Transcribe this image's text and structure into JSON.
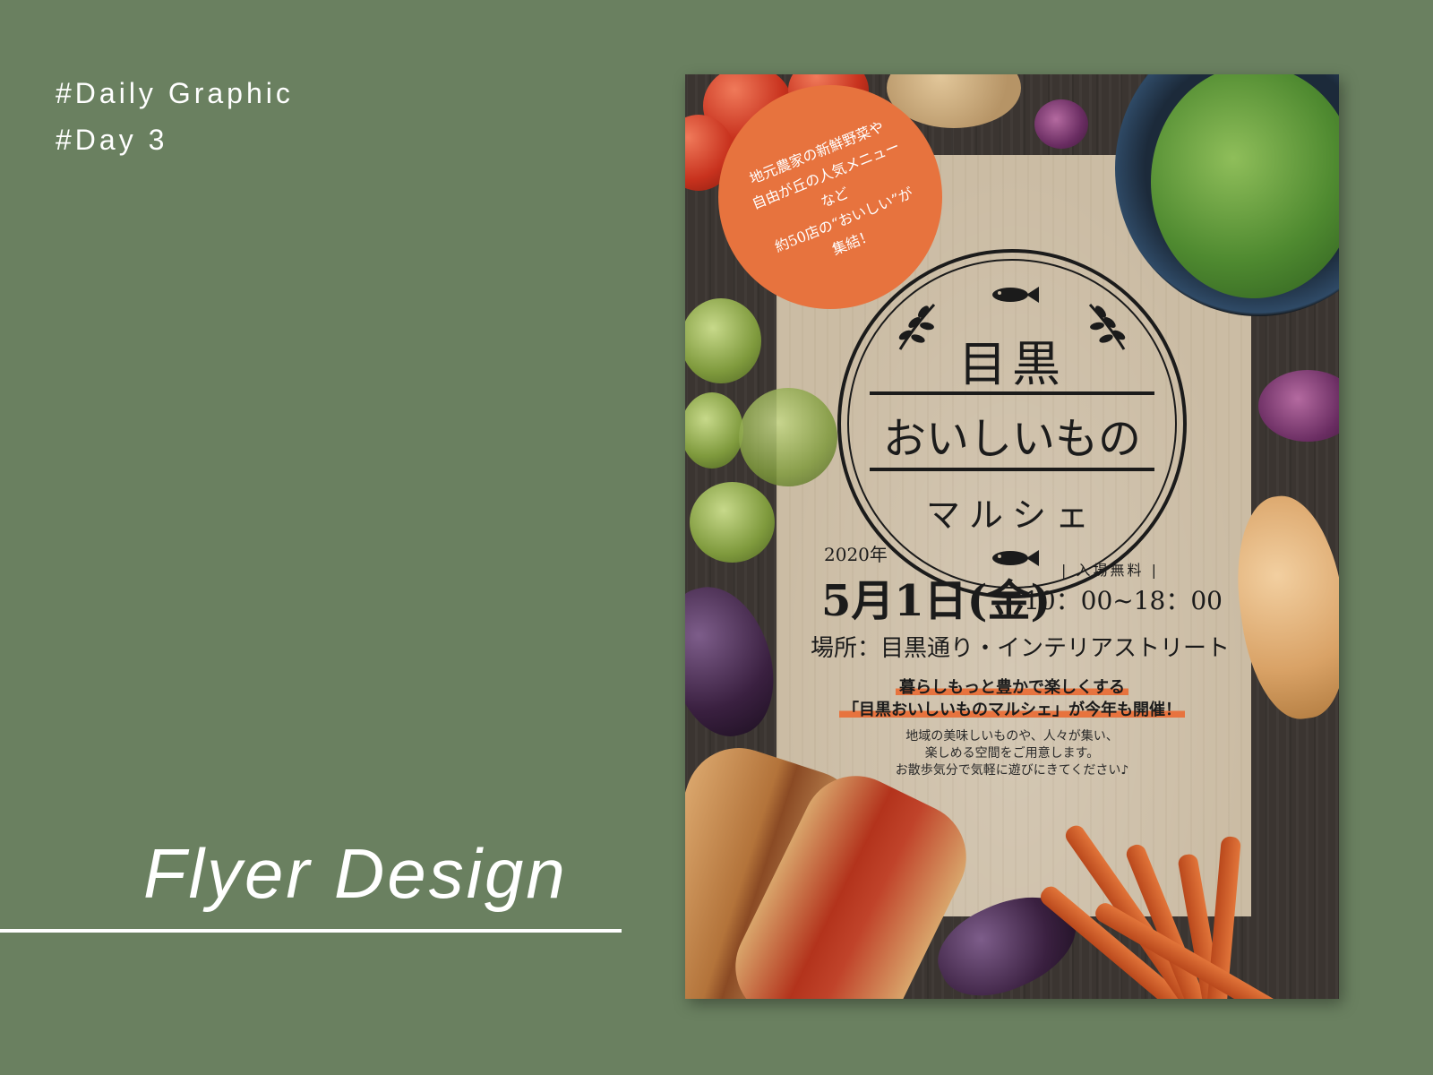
{
  "header": {
    "tag_1": "#Daily Graphic",
    "tag_2": "#Day 3"
  },
  "title": "Flyer Design",
  "flyer": {
    "badge_lines": [
      "地元農家の新鮮野菜や",
      "自由が丘の人気メニュー",
      "など",
      "約50店の“おいしい”が",
      "集結！"
    ],
    "logo": {
      "line_1": "目黒",
      "line_2": "おいしいもの",
      "line_3": "マルシェ"
    },
    "year": "2020年",
    "date": "5月1日(金)",
    "admission": "入場無料",
    "time": "10：00~18：00",
    "venue": "場所：目黒通り・インテリアストリート",
    "catch_1": "暮らしもっと豊かで楽しくする",
    "catch_2": "「目黒おいしいものマルシェ」が今年も開催！",
    "desc_1": "地域の美味しいものや、人々が集い、",
    "desc_2": "楽しめる空間をご用意します。",
    "desc_3": "お散歩気分で気軽に遊びにきてください♪"
  },
  "colors": {
    "background": "#6a8060",
    "accent": "#e7733e",
    "paper": "#cbbca4",
    "wood": "#3b3531"
  }
}
